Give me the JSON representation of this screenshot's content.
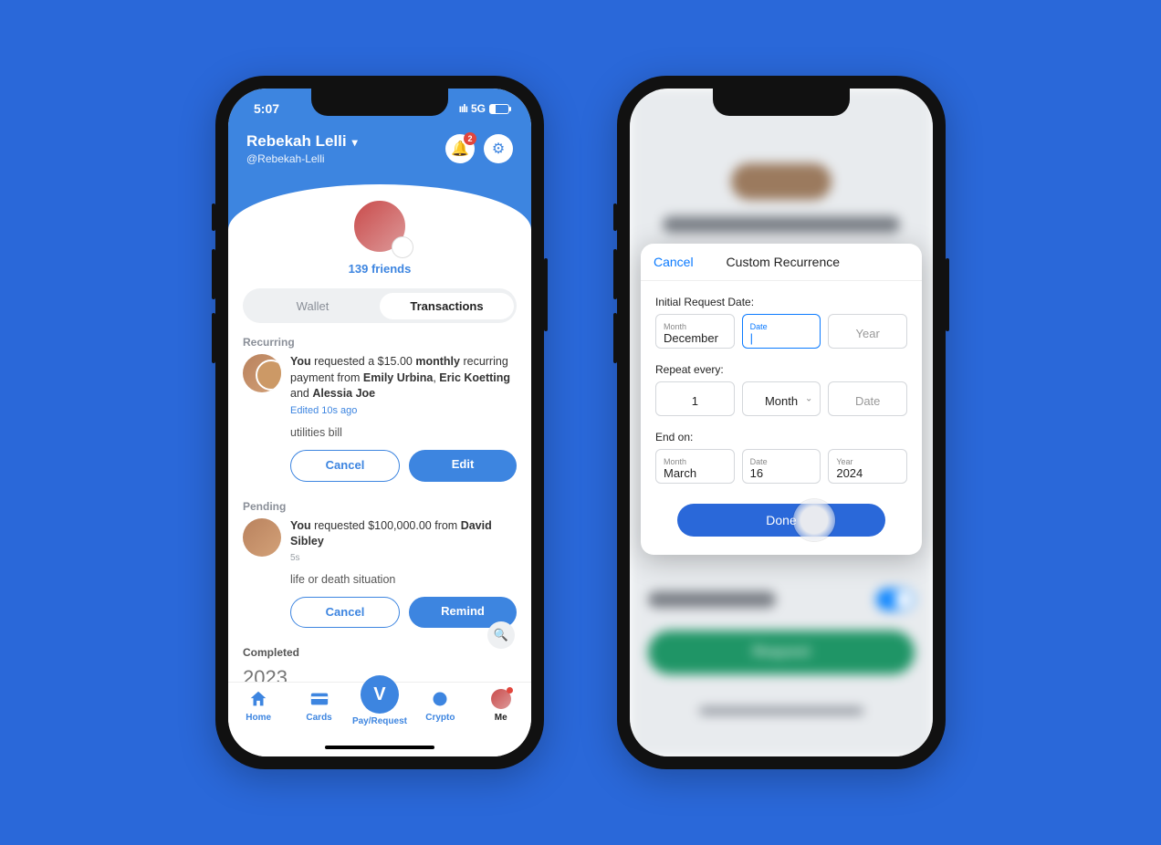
{
  "status": {
    "time": "5:07",
    "carrier": "5G",
    "battery_pct": 32
  },
  "profile": {
    "name": "Rebekah Lelli",
    "handle": "@Rebekah-Lelli",
    "friends": "139 friends",
    "notif_count": "2"
  },
  "tabs_seg": {
    "wallet": "Wallet",
    "transactions": "Transactions"
  },
  "sections": {
    "recurring": "Recurring",
    "pending": "Pending",
    "completed": "Completed"
  },
  "recurring_txn": {
    "line": {
      "you": "You",
      "t1": " requested a $15.00 ",
      "monthly": "monthly",
      "t2": " recurring payment from ",
      "p1": "Emily Urbina",
      "c1": ", ",
      "p2": "Eric Koetting",
      "and": " and ",
      "p3": "Alessia Joe"
    },
    "edited": "Edited 10s ago",
    "note": "utilities bill",
    "cancel": "Cancel",
    "edit": "Edit"
  },
  "pending_txn": {
    "line": {
      "you": "You",
      "t1": " requested $100,000.00 from ",
      "p1": "David Sibley"
    },
    "time": "5s",
    "note": "life or death situation",
    "cancel": "Cancel",
    "remind": "Remind"
  },
  "year": "2023",
  "tabbar": {
    "home": "Home",
    "cards": "Cards",
    "pay": "Pay/Request",
    "crypto": "Crypto",
    "me": "Me"
  },
  "modal": {
    "cancel": "Cancel",
    "title": "Custom Recurrence",
    "g1": "Initial Request Date:",
    "g2": "Repeat every:",
    "g3": "End on:",
    "labels": {
      "month": "Month",
      "date": "Date",
      "year": "Year"
    },
    "initial": {
      "month": "December",
      "date": "",
      "year": ""
    },
    "repeat": {
      "count": "1",
      "unit": "Month",
      "date": "Date"
    },
    "end": {
      "month": "March",
      "date": "16",
      "year": "2024"
    },
    "done": "Done"
  },
  "blur": {
    "request": "Request"
  }
}
